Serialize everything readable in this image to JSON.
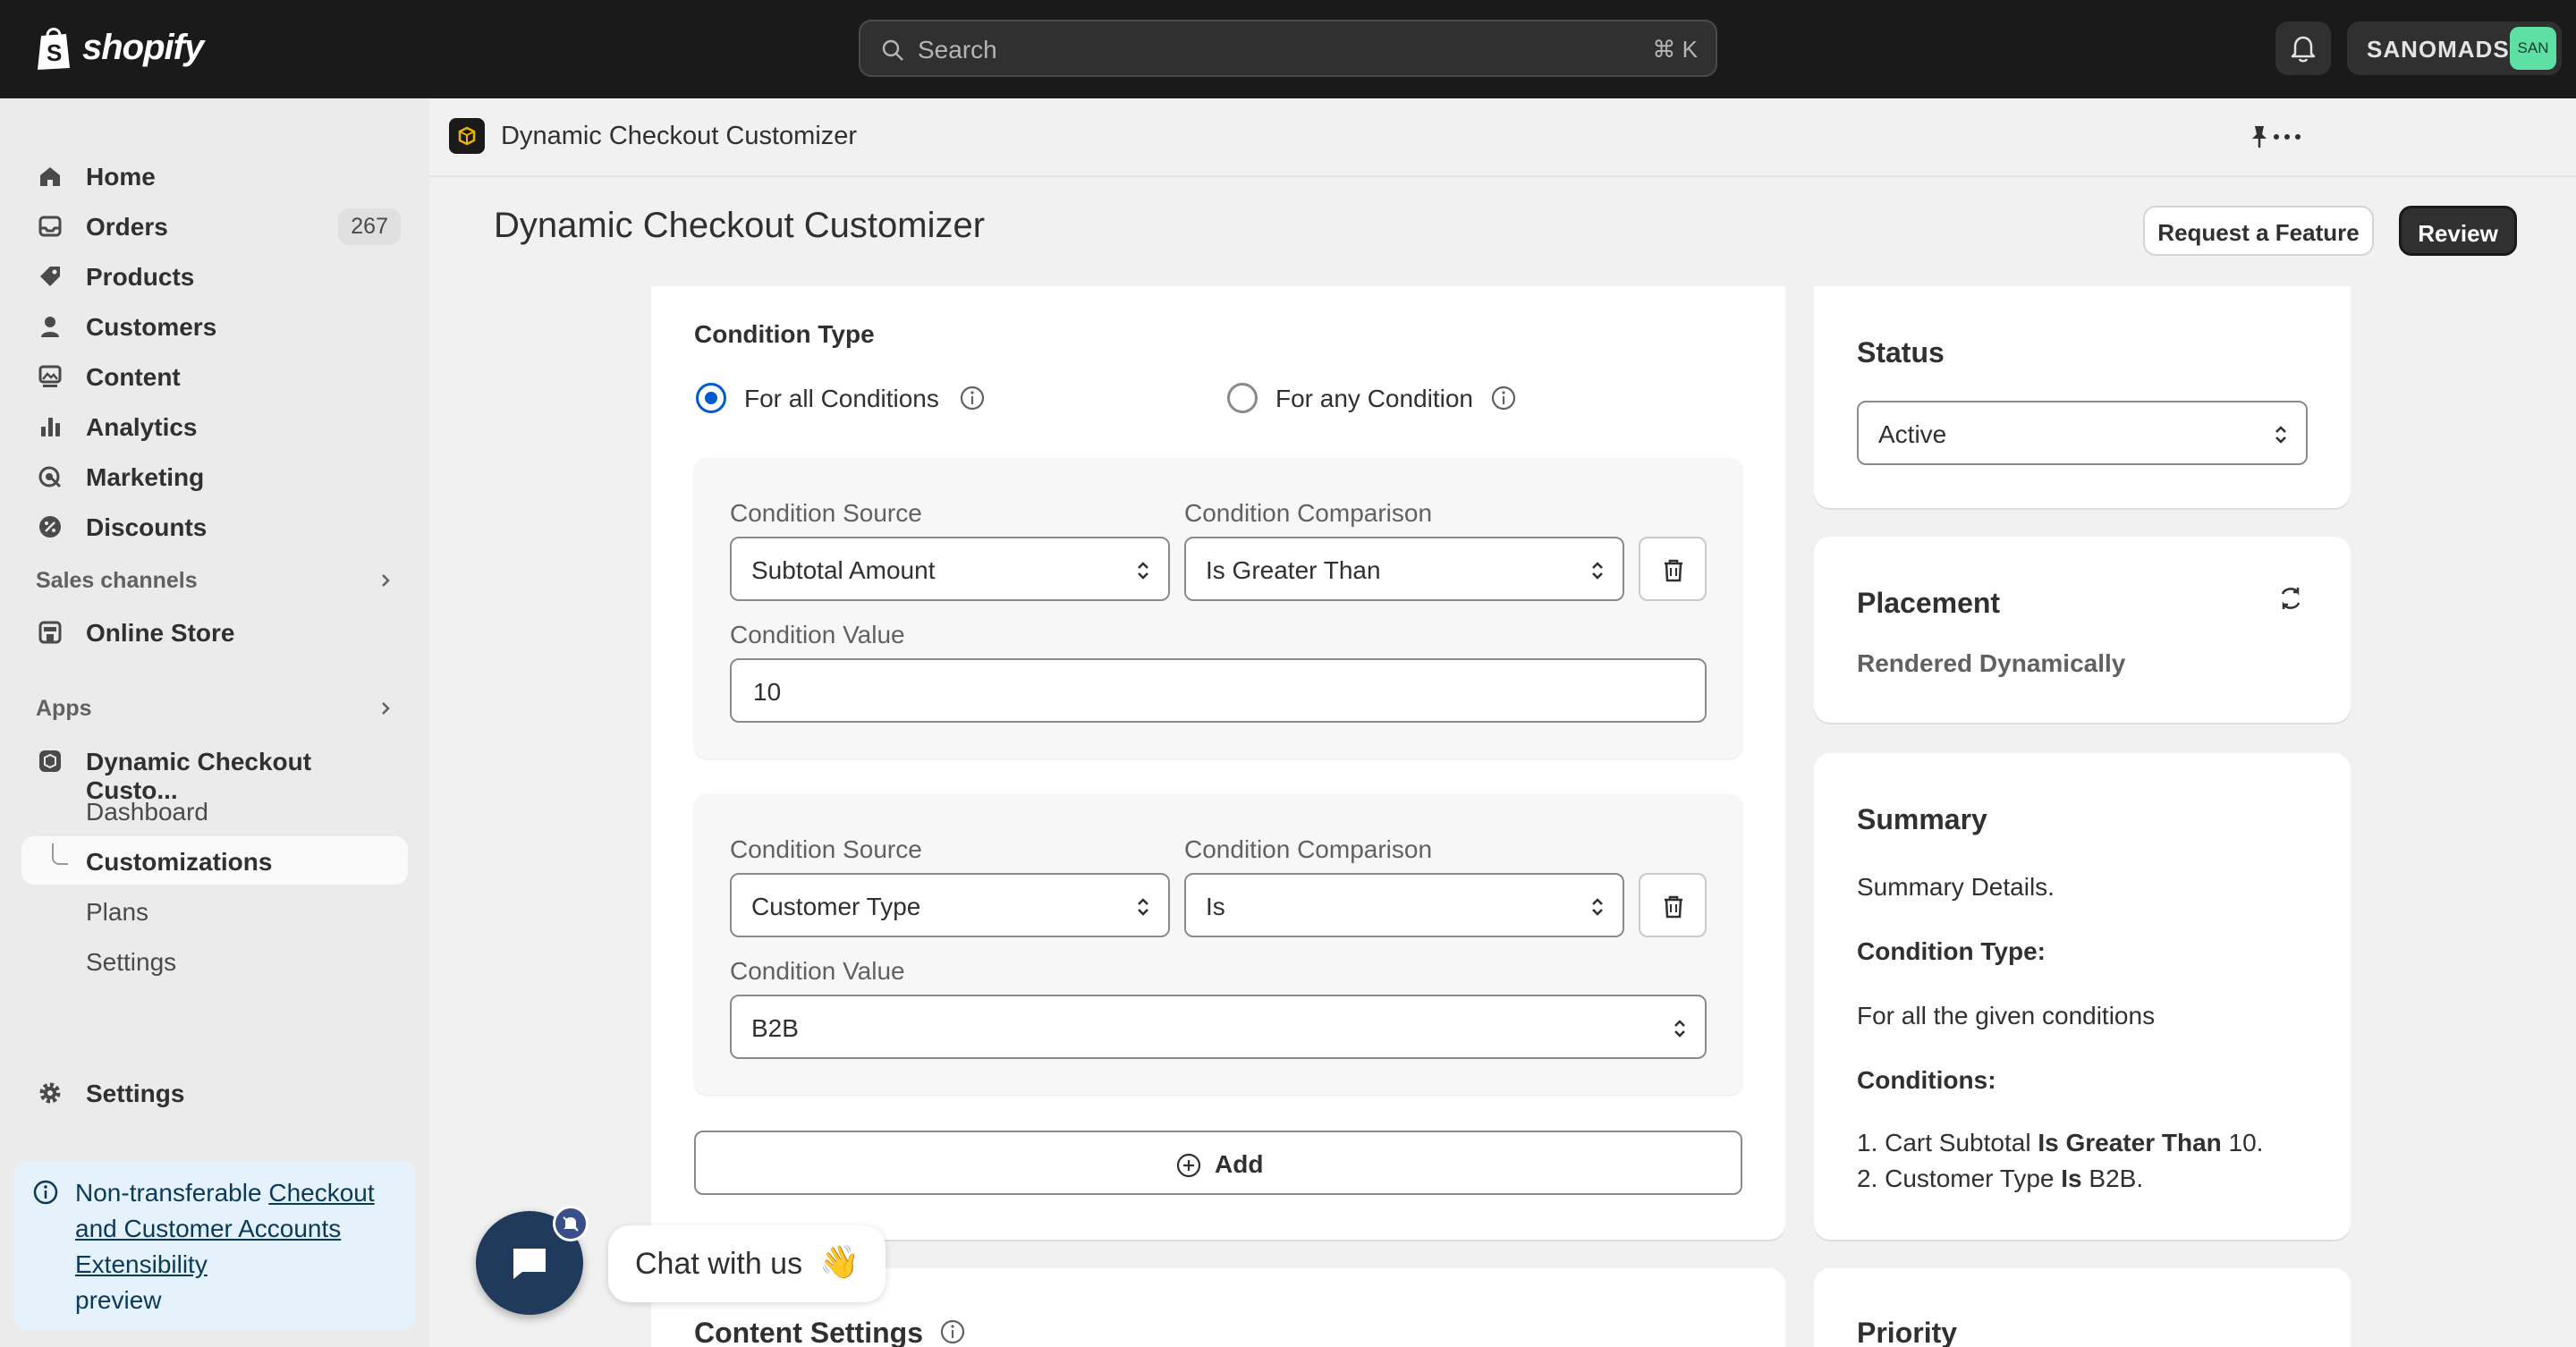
{
  "topbar": {
    "brand": "shopify",
    "search_placeholder": "Search",
    "search_shortcut": "⌘ K",
    "store_name": "SANOMADS",
    "avatar_initials": "SAN"
  },
  "sidebar": {
    "items": [
      {
        "label": "Home",
        "icon": "home-icon"
      },
      {
        "label": "Orders",
        "icon": "inbox-icon",
        "badge": "267"
      },
      {
        "label": "Products",
        "icon": "tag-icon"
      },
      {
        "label": "Customers",
        "icon": "person-icon"
      },
      {
        "label": "Content",
        "icon": "image-icon"
      },
      {
        "label": "Analytics",
        "icon": "bar-chart-icon"
      },
      {
        "label": "Marketing",
        "icon": "target-icon"
      },
      {
        "label": "Discounts",
        "icon": "discount-icon"
      }
    ],
    "sales_channels_label": "Sales channels",
    "online_store_label": "Online Store",
    "apps_label": "Apps",
    "app_name": "Dynamic Checkout Custo...",
    "app_subitems": [
      "Dashboard",
      "Customizations",
      "Plans",
      "Settings"
    ],
    "settings_label": "Settings",
    "notice": {
      "prefix": "Non-transferable",
      "link": "Checkout and Customer Accounts Extensibility",
      "suffix": "preview"
    }
  },
  "appbar": {
    "title": "Dynamic Checkout Customizer"
  },
  "page": {
    "title": "Dynamic Checkout Customizer",
    "request_feature_label": "Request a Feature",
    "review_label": "Review"
  },
  "conditions": {
    "heading": "Condition Type",
    "option_all": "For all Conditions",
    "option_any": "For any Condition",
    "source_label": "Condition Source",
    "comparison_label": "Condition Comparison",
    "value_label": "Condition Value",
    "rows": [
      {
        "source": "Subtotal Amount",
        "comparison": "Is Greater Than",
        "value": "10"
      },
      {
        "source": "Customer Type",
        "comparison": "Is",
        "value": "B2B"
      }
    ],
    "add_label": "Add"
  },
  "content_settings_heading": "Content Settings",
  "status": {
    "heading": "Status",
    "value": "Active"
  },
  "placement": {
    "heading": "Placement",
    "value": "Rendered Dynamically"
  },
  "summary": {
    "heading": "Summary",
    "details": "Summary Details.",
    "condition_type_label": "Condition Type:",
    "condition_type_value": "For all the given conditions",
    "conditions_label": "Conditions:",
    "line1_prefix": "1. Cart Subtotal",
    "line1_op": "Is Greater Than",
    "line1_value": "10.",
    "line2_prefix": "2. Customer Type",
    "line2_op": "Is",
    "line2_value": "B2B."
  },
  "priority_heading": "Priority",
  "chat": {
    "label": "Chat with us",
    "emoji": "👋"
  }
}
